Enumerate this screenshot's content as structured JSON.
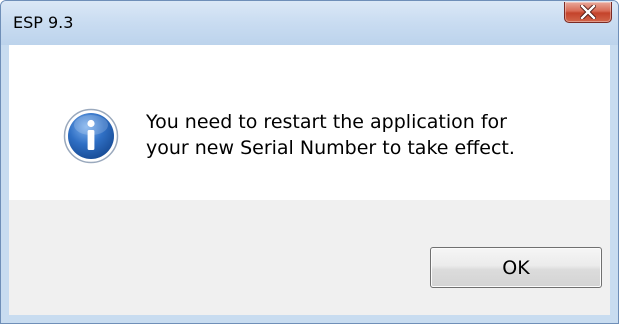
{
  "window": {
    "title": "ESP 9.3",
    "close_icon": "close-icon"
  },
  "dialog": {
    "icon": "info-icon",
    "message_line1": "You need to restart the application for",
    "message_line2": "your new Serial Number to take effect.",
    "ok_label": "OK"
  },
  "colors": {
    "titlebar": "#c9dcf1",
    "close_button": "#c4432b",
    "info_icon": "#2a63b8",
    "button_area": "#f0f0f0"
  }
}
